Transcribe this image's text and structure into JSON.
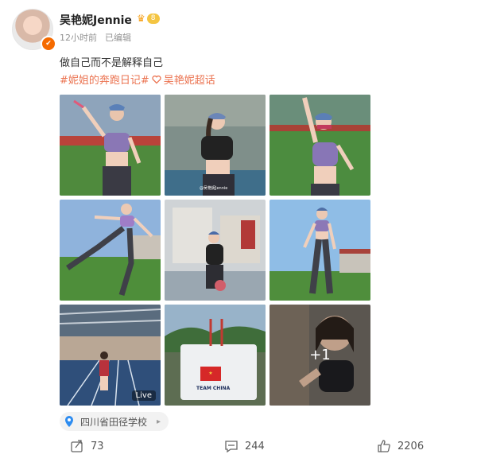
{
  "post": {
    "username": "吴艳妮Jennie",
    "vip_level": "8",
    "time": "12小时前",
    "edited": "已编辑",
    "text": "做自己而不是解释自己",
    "topic1": "#妮姐的奔跑日记#",
    "topic2": "吴艳妮超话"
  },
  "photos": {
    "watermark": "@吴艳妮Jennie",
    "live_label": "Live",
    "more_count": "+1",
    "team_china_text": "TEAM CHINA"
  },
  "location": "四川省田径学校",
  "actions": {
    "repost": "73",
    "comment": "244",
    "like": "2206"
  },
  "colors": {
    "topic": "#eb7350",
    "meta": "#939393",
    "location_pin": "#2d8cf0"
  }
}
